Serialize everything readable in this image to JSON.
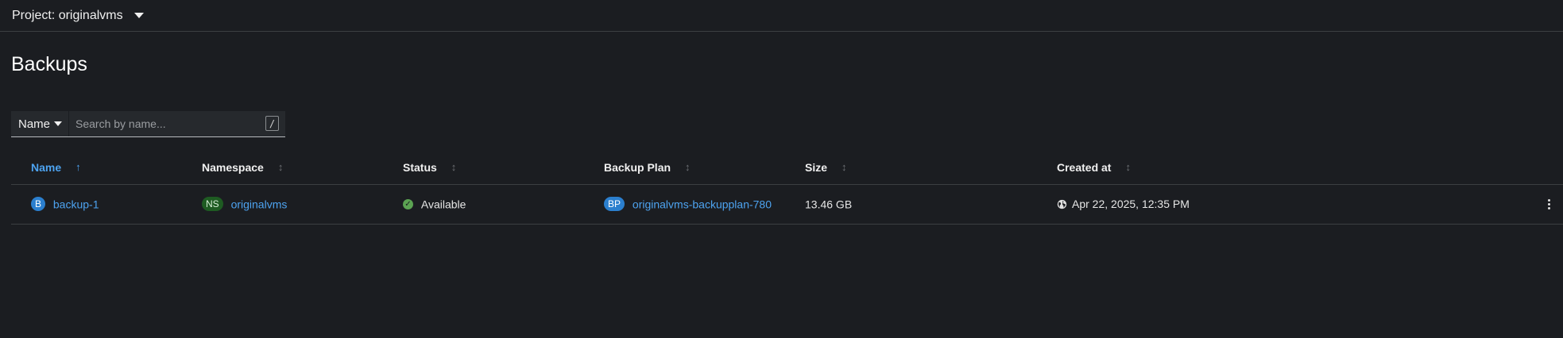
{
  "project": {
    "label": "Project: originalvms"
  },
  "page": {
    "title": "Backups"
  },
  "filter": {
    "selected": "Name",
    "search_placeholder": "Search by name...",
    "shortcut_hint": "/"
  },
  "table": {
    "columns": [
      {
        "label": "Name",
        "sort": "ascending"
      },
      {
        "label": "Namespace",
        "sort": "none"
      },
      {
        "label": "Status",
        "sort": "none"
      },
      {
        "label": "Backup Plan",
        "sort": "none"
      },
      {
        "label": "Size",
        "sort": "none"
      },
      {
        "label": "Created at",
        "sort": "none"
      }
    ],
    "rows": [
      {
        "name_badge": "B",
        "name": "backup-1",
        "namespace_badge": "NS",
        "namespace": "originalvms",
        "status": "Available",
        "backup_plan_badge": "BP",
        "backup_plan": "originalvms-backupplan-780",
        "size": "13.46 GB",
        "created_at": "Apr 22, 2025, 12:35 PM"
      }
    ]
  },
  "colors": {
    "background": "#1b1d21",
    "link": "#4da3f0",
    "status_ok": "#5ba352",
    "ns_badge": "#1e5b22",
    "resource_badge": "#2b7fce"
  }
}
